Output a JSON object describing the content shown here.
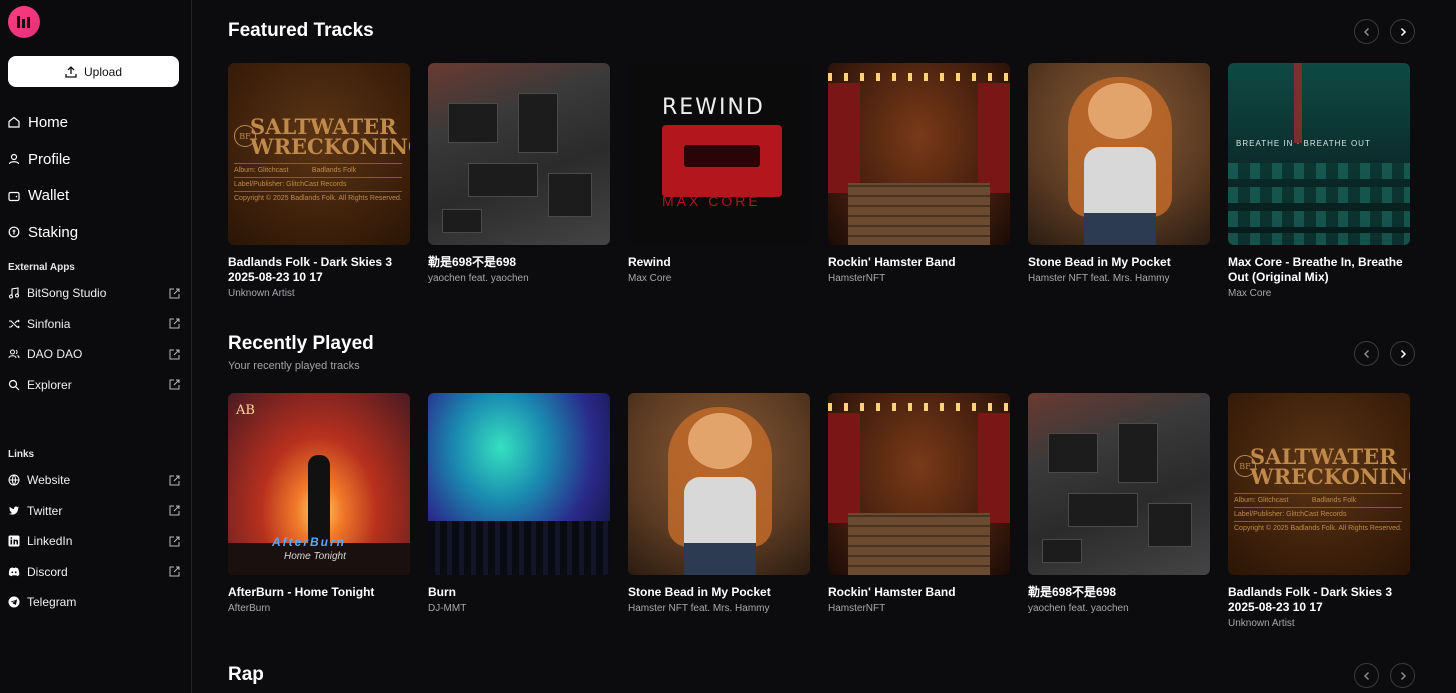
{
  "sidebar": {
    "upload_label": "Upload",
    "nav": [
      {
        "label": "Home",
        "icon": "home-icon"
      },
      {
        "label": "Profile",
        "icon": "user-icon"
      },
      {
        "label": "Wallet",
        "icon": "wallet-icon"
      },
      {
        "label": "Staking",
        "icon": "staking-icon"
      }
    ],
    "external_apps_label": "External Apps",
    "external_apps": [
      {
        "label": "BitSong Studio",
        "icon": "music-icon"
      },
      {
        "label": "Sinfonia",
        "icon": "shuffle-icon"
      },
      {
        "label": "DAO DAO",
        "icon": "users-icon"
      },
      {
        "label": "Explorer",
        "icon": "search-icon"
      }
    ],
    "links_label": "Links",
    "links": [
      {
        "label": "Website",
        "icon": "globe-icon"
      },
      {
        "label": "Twitter",
        "icon": "twitter-icon"
      },
      {
        "label": "LinkedIn",
        "icon": "linkedin-icon"
      },
      {
        "label": "Discord",
        "icon": "discord-icon"
      },
      {
        "label": "Telegram",
        "icon": "telegram-icon"
      }
    ]
  },
  "featured": {
    "title": "Featured Tracks",
    "tracks": [
      {
        "title": "Badlands Folk - Dark Skies 3 2025-08-23 10 17",
        "artist": "Unknown Artist",
        "art": "saltwater"
      },
      {
        "title": "勒是698不是698",
        "artist": "yaochen feat. yaochen",
        "art": "board"
      },
      {
        "title": "Rewind",
        "artist": "Max Core",
        "art": "rewind"
      },
      {
        "title": "Rockin' Hamster Band",
        "artist": "HamsterNFT",
        "art": "stage"
      },
      {
        "title": "Stone Bead in My Pocket",
        "artist": "Hamster NFT feat. Mrs. Hammy",
        "art": "hamster"
      },
      {
        "title": "Max Core - Breathe In, Breathe Out (Original Mix)",
        "artist": "Max Core",
        "art": "waves"
      }
    ]
  },
  "recent": {
    "title": "Recently Played",
    "subtitle": "Your recently played tracks",
    "tracks": [
      {
        "title": "AfterBurn - Home Tonight",
        "artist": "AfterBurn",
        "art": "afterburn"
      },
      {
        "title": "Burn",
        "artist": "DJ-MMT",
        "art": "concert"
      },
      {
        "title": "Stone Bead in My Pocket",
        "artist": "Hamster NFT feat. Mrs. Hammy",
        "art": "hamster"
      },
      {
        "title": "Rockin' Hamster Band",
        "artist": "HamsterNFT",
        "art": "stage"
      },
      {
        "title": "勒是698不是698",
        "artist": "yaochen feat. yaochen",
        "art": "board"
      },
      {
        "title": "Badlands Folk - Dark Skies 3 2025-08-23 10 17",
        "artist": "Unknown Artist",
        "art": "saltwater"
      }
    ]
  },
  "rap": {
    "title": "Rap"
  },
  "art_text": {
    "saltwater": {
      "bf": "BF",
      "line1": "SALTWATER",
      "line2": "WRECKONING",
      "album": "Album: Glitchcast",
      "artist": "Badlands Folk",
      "label": "Label/Publisher: GlitchCast Records",
      "copyright": "Copyright © 2025 Badlands Folk. All Rights Reserved."
    },
    "rewind": {
      "title": "REWIND",
      "artist": "MAX CORE"
    },
    "waves": {
      "text": "BREATHE IN · BREATHE OUT"
    },
    "afterburn": {
      "mark": "AB",
      "name": "AfterBurn",
      "track": "Home Tonight"
    }
  },
  "colors": {
    "background": "#0c0c0e",
    "brand": "#ff3d7f"
  }
}
